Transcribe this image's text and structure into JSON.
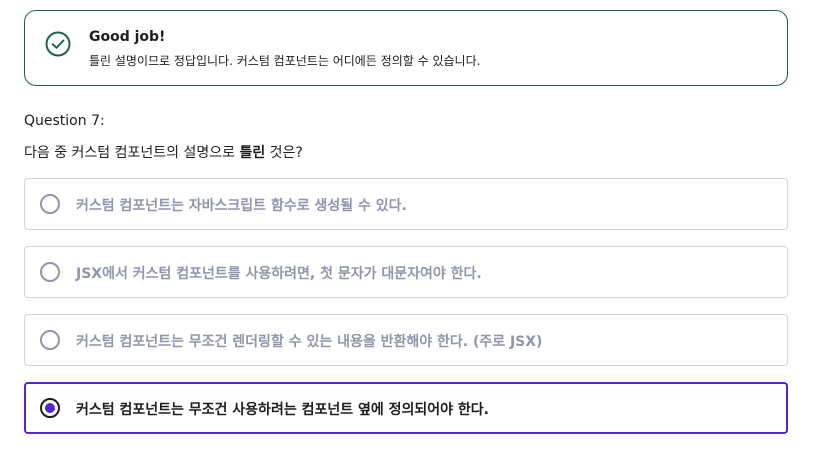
{
  "feedback": {
    "status": "correct",
    "icon": "check-circle-icon",
    "title": "Good job!",
    "description": "틀린 설명이므로 정답입니다. 커스텀 컴포넌트는 어디에든 정의할 수 있습니다.",
    "color": "#1e6055"
  },
  "question": {
    "label": "Question 7:",
    "text_before": "다음 중 커스텀 컴포넌트의 설명으로 ",
    "text_emphasis": "틀린",
    "text_after": " 것은?"
  },
  "options": [
    {
      "label": "커스텀 컴포넌트는 자바스크립트 함수로 생성될 수 있다.",
      "selected": false
    },
    {
      "label": "JSX에서 커스텀 컴포넌트를 사용하려면, 첫 문자가 대문자여야 한다.",
      "selected": false
    },
    {
      "label": "커스텀 컴포넌트는 무조건 렌더링할 수 있는 내용을 반환해야 한다. (주로 JSX)",
      "selected": false
    },
    {
      "label": "커스텀 컴포넌트는 무조건 사용하려는 컴포넌트 옆에 정의되어야 한다.",
      "selected": true
    }
  ],
  "colors": {
    "accent": "#5624d0",
    "success": "#1e6055",
    "muted_text": "#9194ac",
    "border": "#d1d2e0"
  }
}
